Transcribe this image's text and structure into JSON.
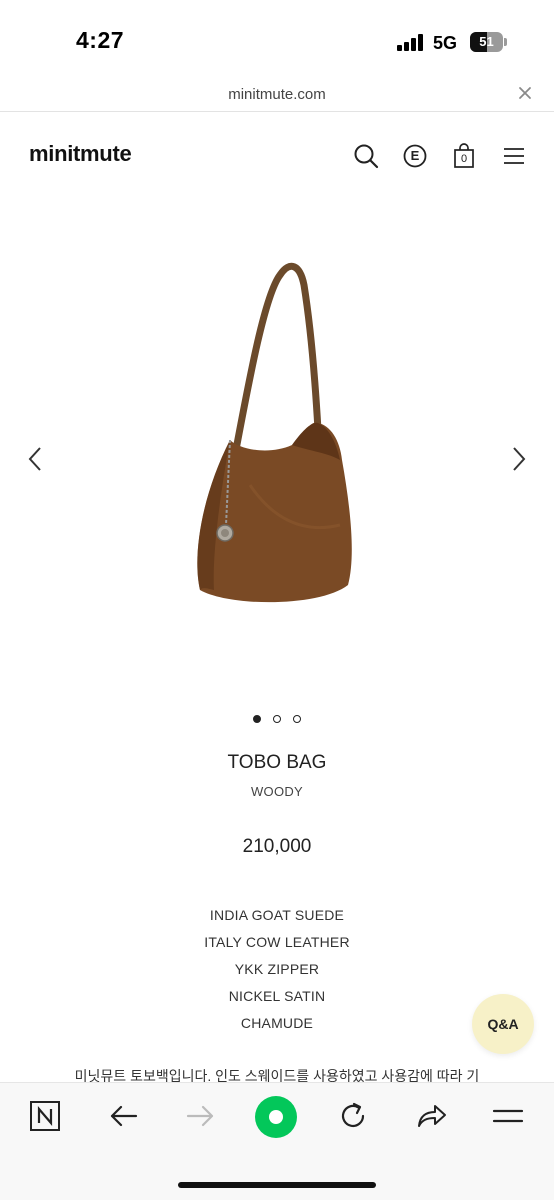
{
  "status": {
    "time": "4:27",
    "network": "5G",
    "battery": "51",
    "battery_level": 0.51
  },
  "url_bar": {
    "domain": "minitmute.com"
  },
  "header": {
    "logo": "minitmute",
    "icons": [
      "search-icon",
      "e-icon",
      "cart-icon",
      "menu-icon"
    ],
    "cart_count": "0",
    "e_label": "E"
  },
  "gallery": {
    "image_alt": "brown suede hobo bag",
    "slide_count": 3,
    "active_slide": 1
  },
  "product": {
    "name": "TOBO BAG",
    "color": "WOODY",
    "price": "210,000",
    "materials": [
      "INDIA GOAT SUEDE",
      "ITALY COW LEATHER",
      "YKK ZIPPER",
      "NICKEL SATIN",
      "CHAMUDE"
    ],
    "description": "미닛뮤트 토보백입니다. 인도 스웨이드를 사용하였고 사용감에 따라 기"
  },
  "qa_button": {
    "label": "Q&A"
  },
  "colors": {
    "bag_brown": "#7a4a25",
    "qa_bg": "#f7f1c8",
    "browser_green": "#03c75a"
  }
}
